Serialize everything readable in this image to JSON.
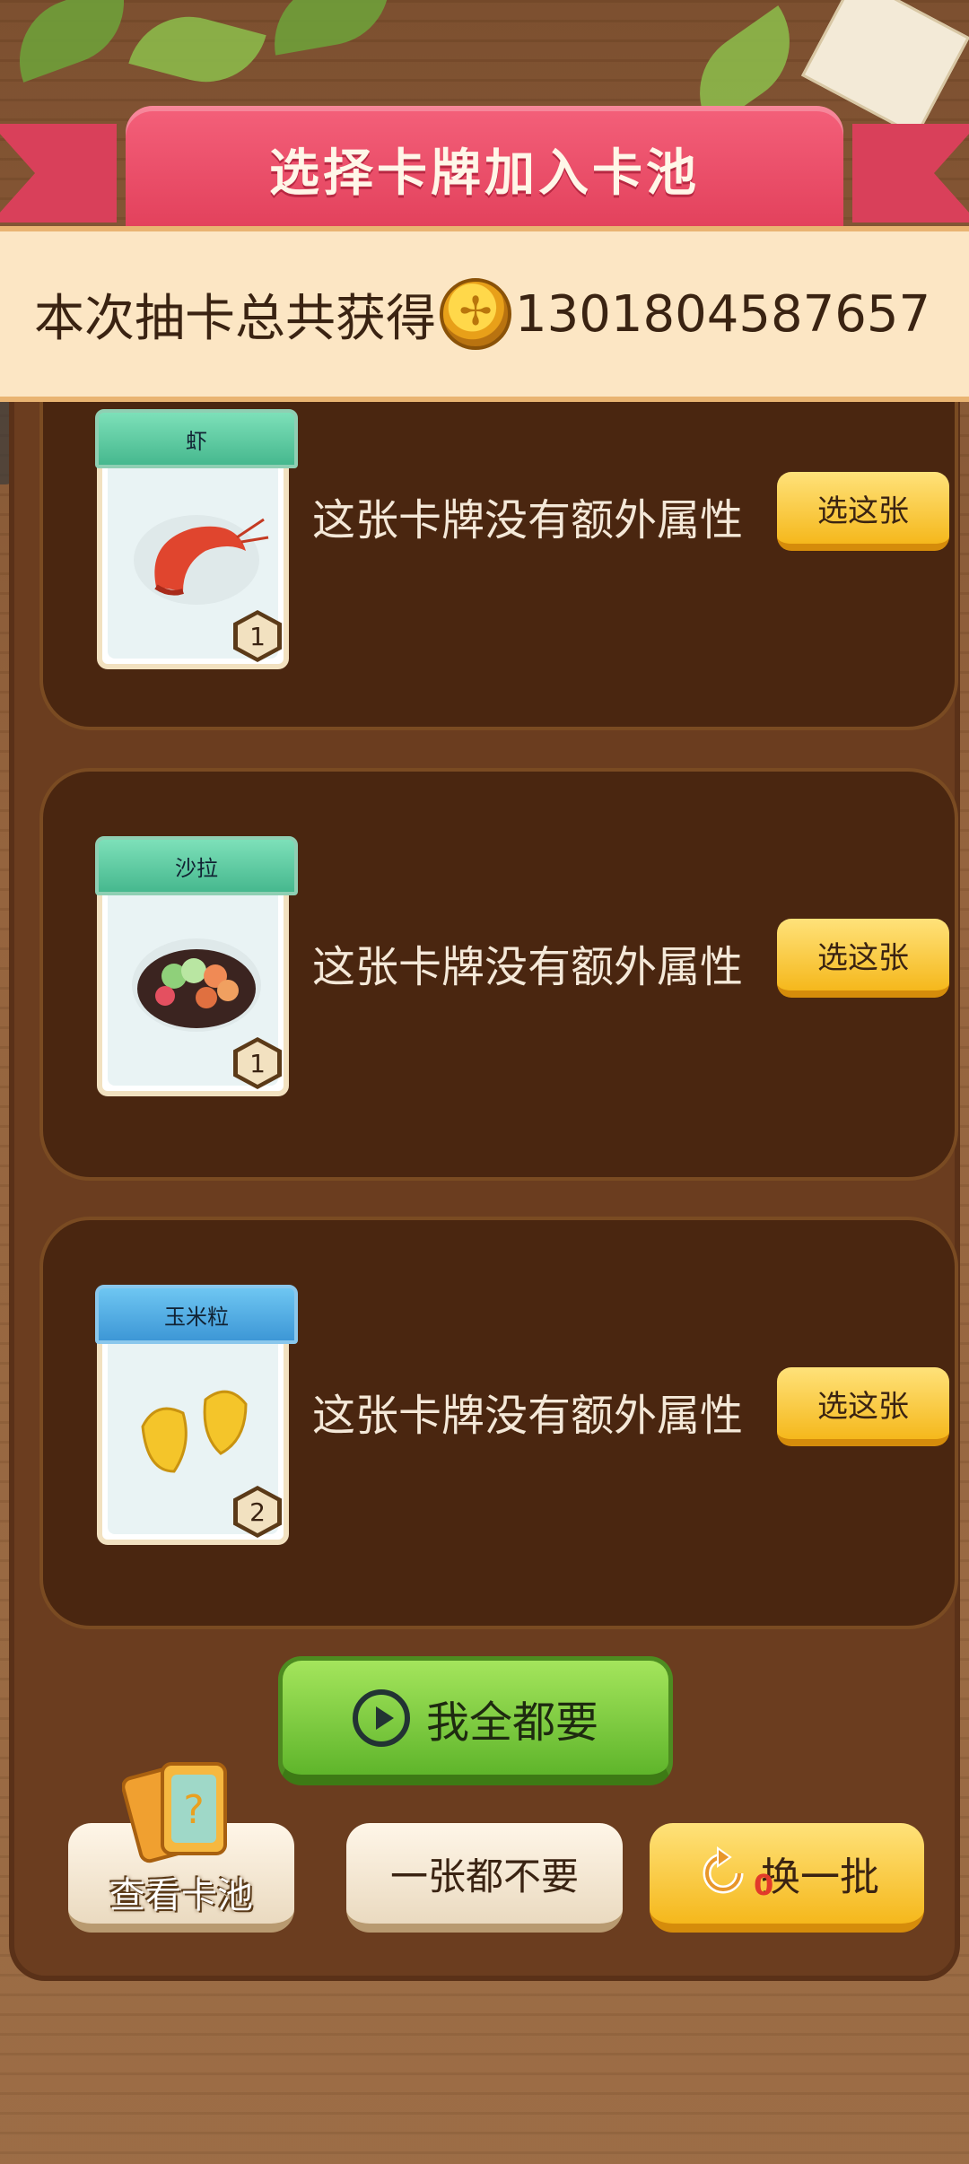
{
  "header": {
    "title": "选择卡牌加入卡池"
  },
  "summary": {
    "label": "本次抽卡总共获得",
    "coin_icon": "gold-coin-icon",
    "value": "1301804587657"
  },
  "cards": [
    {
      "name": "虾",
      "level": "1",
      "desc": "这张卡牌没有额外属性",
      "button": "选这张",
      "icon": "shrimp-icon"
    },
    {
      "name": "沙拉",
      "level": "1",
      "desc": "这张卡牌没有额外属性",
      "button": "选这张",
      "icon": "salad-icon"
    },
    {
      "name": "玉米粒",
      "level": "2",
      "desc": "这张卡牌没有额外属性",
      "button": "选这张",
      "icon": "corn-kernel-icon"
    }
  ],
  "actions": {
    "want_all": "我全都要",
    "view_pool": "查看卡池",
    "none": "一张都不要",
    "refresh": "换一批",
    "refresh_count": "0"
  },
  "colors": {
    "ribbon": "#e2405b",
    "panel": "#4a2610",
    "button_yellow": "#f5b81c",
    "button_green": "#5fb52b"
  }
}
